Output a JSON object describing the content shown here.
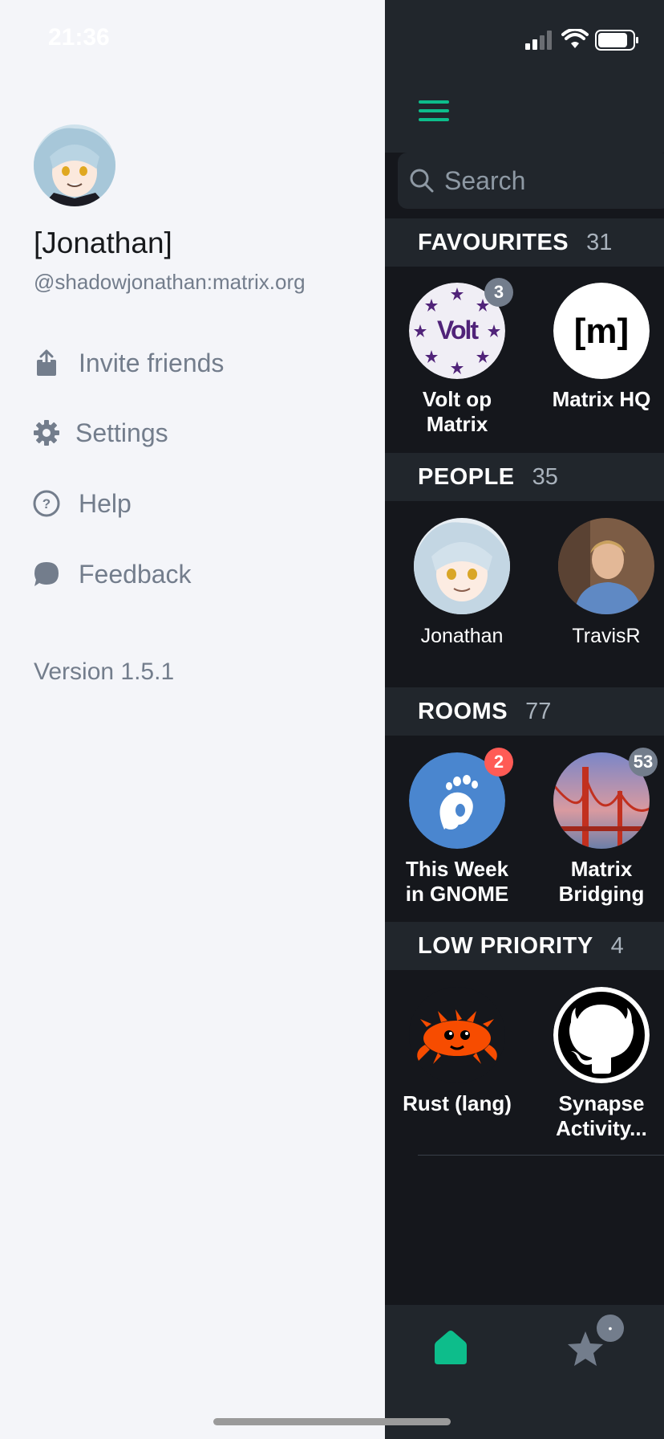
{
  "status_bar": {
    "time": "21:36"
  },
  "drawer": {
    "display_name": "[Jonathan]",
    "user_id": "@shadowjonathan:matrix.org",
    "menu": [
      {
        "label": "Invite friends",
        "icon": "share-icon"
      },
      {
        "label": "Settings",
        "icon": "gear-icon"
      },
      {
        "label": "Help",
        "icon": "help-icon"
      },
      {
        "label": "Feedback",
        "icon": "chat-bubble-icon"
      }
    ],
    "version": "Version 1.5.1"
  },
  "search": {
    "placeholder": "Search"
  },
  "sections": {
    "favourites": {
      "title": "FAVOURITES",
      "count": "31",
      "rooms": [
        {
          "name_line1": "Volt op",
          "name_line2": "Matrix",
          "badge": "3"
        },
        {
          "name_line1": "Matrix HQ",
          "name_line2": ""
        }
      ]
    },
    "people": {
      "title": "PEOPLE",
      "count": "35",
      "rooms": [
        {
          "name": "Jonathan"
        },
        {
          "name": "TravisR"
        }
      ]
    },
    "rooms": {
      "title": "ROOMS",
      "count": "77",
      "rooms": [
        {
          "name_line1": "This Week",
          "name_line2": "in GNOME",
          "badge": "2"
        },
        {
          "name_line1": "Matrix",
          "name_line2": "Bridging",
          "badge": "53"
        }
      ]
    },
    "low_priority": {
      "title": "LOW PRIORITY",
      "count": "4",
      "rooms": [
        {
          "name_line1": "Rust (lang)",
          "name_line2": ""
        },
        {
          "name_line1": "Synapse",
          "name_line2": "Activity..."
        }
      ]
    }
  },
  "avatar_text": {
    "volt": "Volt",
    "matrix": "[m]"
  },
  "colors": {
    "accent": "#0dbd8b",
    "badge_alert": "#ff5b55",
    "badge_neutral": "#737d8c"
  }
}
